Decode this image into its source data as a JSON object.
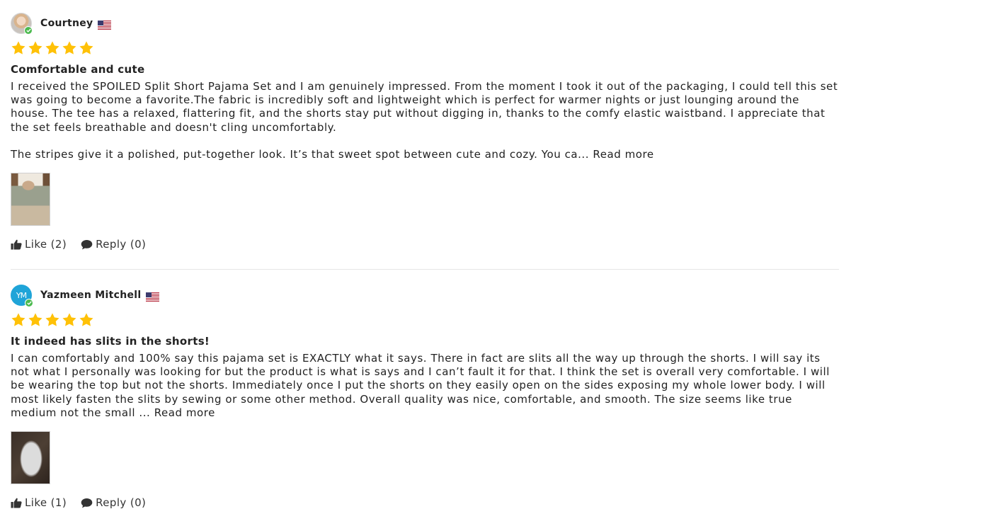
{
  "reviews": [
    {
      "author": "Courtney",
      "country": "US",
      "rating": 5,
      "title": "Comfortable and cute",
      "paragraphs": [
        "I received the SPOILED Split Short Pajama Set and I am genuinely impressed. From the moment I took it out of the packaging, I could tell this set was going to become a favorite.The fabric is incredibly soft and lightweight which is perfect for warmer nights or just lounging around the house. The tee has a relaxed, flattering fit, and the shorts stay put without digging in, thanks to the comfy elastic waistband. I appreciate that the set feels breathable and doesn't cling uncomfortably.",
        "The stripes give it a polished, put-together look. It’s that sweet spot between cute and cozy. You ca... "
      ],
      "read_more": "Read more",
      "like_label": "Like (2)",
      "reply_label": "Reply (0)"
    },
    {
      "author": "Yazmeen Mitchell",
      "avatar_initials": "YM",
      "country": "US",
      "rating": 5,
      "title": "It indeed has slits in the shorts!",
      "paragraphs": [
        "I can comfortably and 100% say this pajama set is EXACTLY what it says. There in fact are slits all the way up through the shorts. I will say its not what I personally was looking for but the product is what is says and I can’t fault it for that. I think the set is overall very comfortable. I will be wearing the top but not the shorts. Immediately once I put the shorts on they easily open on the sides exposing my whole lower body. I will most likely fasten the slits by sewing or some other method. Overall quality was nice, comfortable, and smooth. The size seems like true medium not the small ... "
      ],
      "read_more": "Read more",
      "like_label": "Like (1)",
      "reply_label": "Reply (0)"
    }
  ],
  "colors": {
    "star": "#FFC107",
    "verified": "#4CBA4F",
    "avatar_initials_bg": "#1FA4D8",
    "divider": "#E6E6E6"
  },
  "icons": {
    "verified": "check-badge-icon",
    "flag": "us-flag-icon",
    "star": "star-icon",
    "like": "thumbs-up-icon",
    "reply": "speech-bubble-icon"
  }
}
